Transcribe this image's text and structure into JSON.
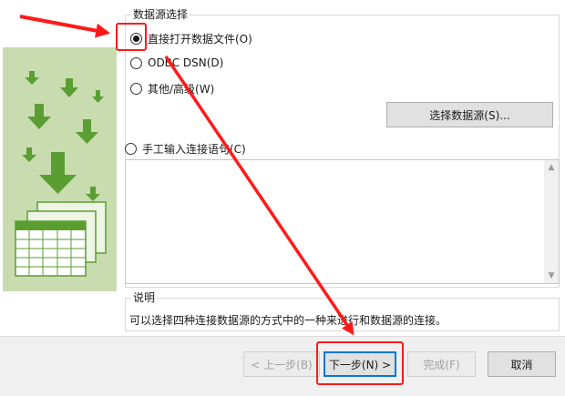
{
  "group": {
    "title": "数据源选择",
    "options": [
      {
        "label": "直接打开数据文件(O)",
        "checked": true
      },
      {
        "label": "ODBC DSN(D)",
        "checked": false
      },
      {
        "label": "其他/高级(W)",
        "checked": false
      },
      {
        "label": "手工输入连接语句(C)",
        "checked": false
      }
    ],
    "select_source_label": "选择数据源(S)...",
    "connection_text": ""
  },
  "description": {
    "title": "说明",
    "text": "可以选择四种连接数据源的方式中的一种来进行和数据源的连接。"
  },
  "footer": {
    "prev_label": "< 上一步(B)",
    "next_label": "下一步(N) >",
    "finish_label": "完成(F)",
    "cancel_label": "取消"
  },
  "colors": {
    "illustration_bg": "#c9dcb0",
    "arrow_green": "#5a9e32",
    "annotation_red": "#ff1a1a",
    "default_button_border": "#0078d7"
  },
  "icons": {
    "illustration": "green-down-arrows-and-spreadsheets-icon",
    "scroll_up": "chevron-up-icon",
    "scroll_down": "chevron-down-icon"
  }
}
